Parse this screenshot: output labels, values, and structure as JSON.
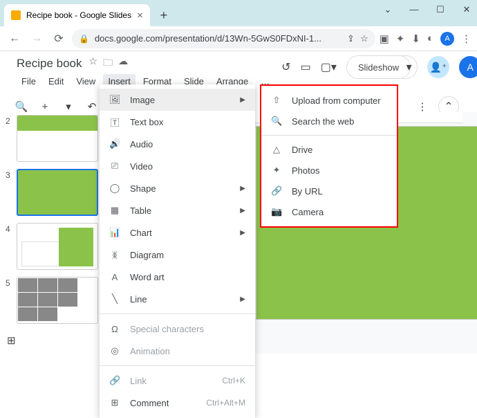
{
  "browser": {
    "tab_title": "Recipe book - Google Slides",
    "url": "docs.google.com/presentation/d/13Wn-5GwS0FDxNI-1..."
  },
  "doc": {
    "title": "Recipe book",
    "avatar_letter": "A"
  },
  "menubar": {
    "file": "File",
    "edit": "Edit",
    "view": "View",
    "insert": "Insert",
    "format": "Format",
    "slide": "Slide",
    "arrange": "Arrange",
    "more": "…"
  },
  "header": {
    "slideshow": "Slideshow"
  },
  "insert_menu": {
    "image": "Image",
    "text_box": "Text box",
    "audio": "Audio",
    "video": "Video",
    "shape": "Shape",
    "table": "Table",
    "chart": "Chart",
    "diagram": "Diagram",
    "word_art": "Word art",
    "line": "Line",
    "special_chars": "Special characters",
    "animation": "Animation",
    "link": "Link",
    "link_sc": "Ctrl+K",
    "comment": "Comment",
    "comment_sc": "Ctrl+Alt+M"
  },
  "image_submenu": {
    "upload": "Upload from computer",
    "search": "Search the web",
    "drive": "Drive",
    "photos": "Photos",
    "by_url": "By URL",
    "camera": "Camera"
  },
  "thumbs": {
    "n2": "2",
    "n3": "3",
    "n4": "4",
    "n5": "5"
  }
}
